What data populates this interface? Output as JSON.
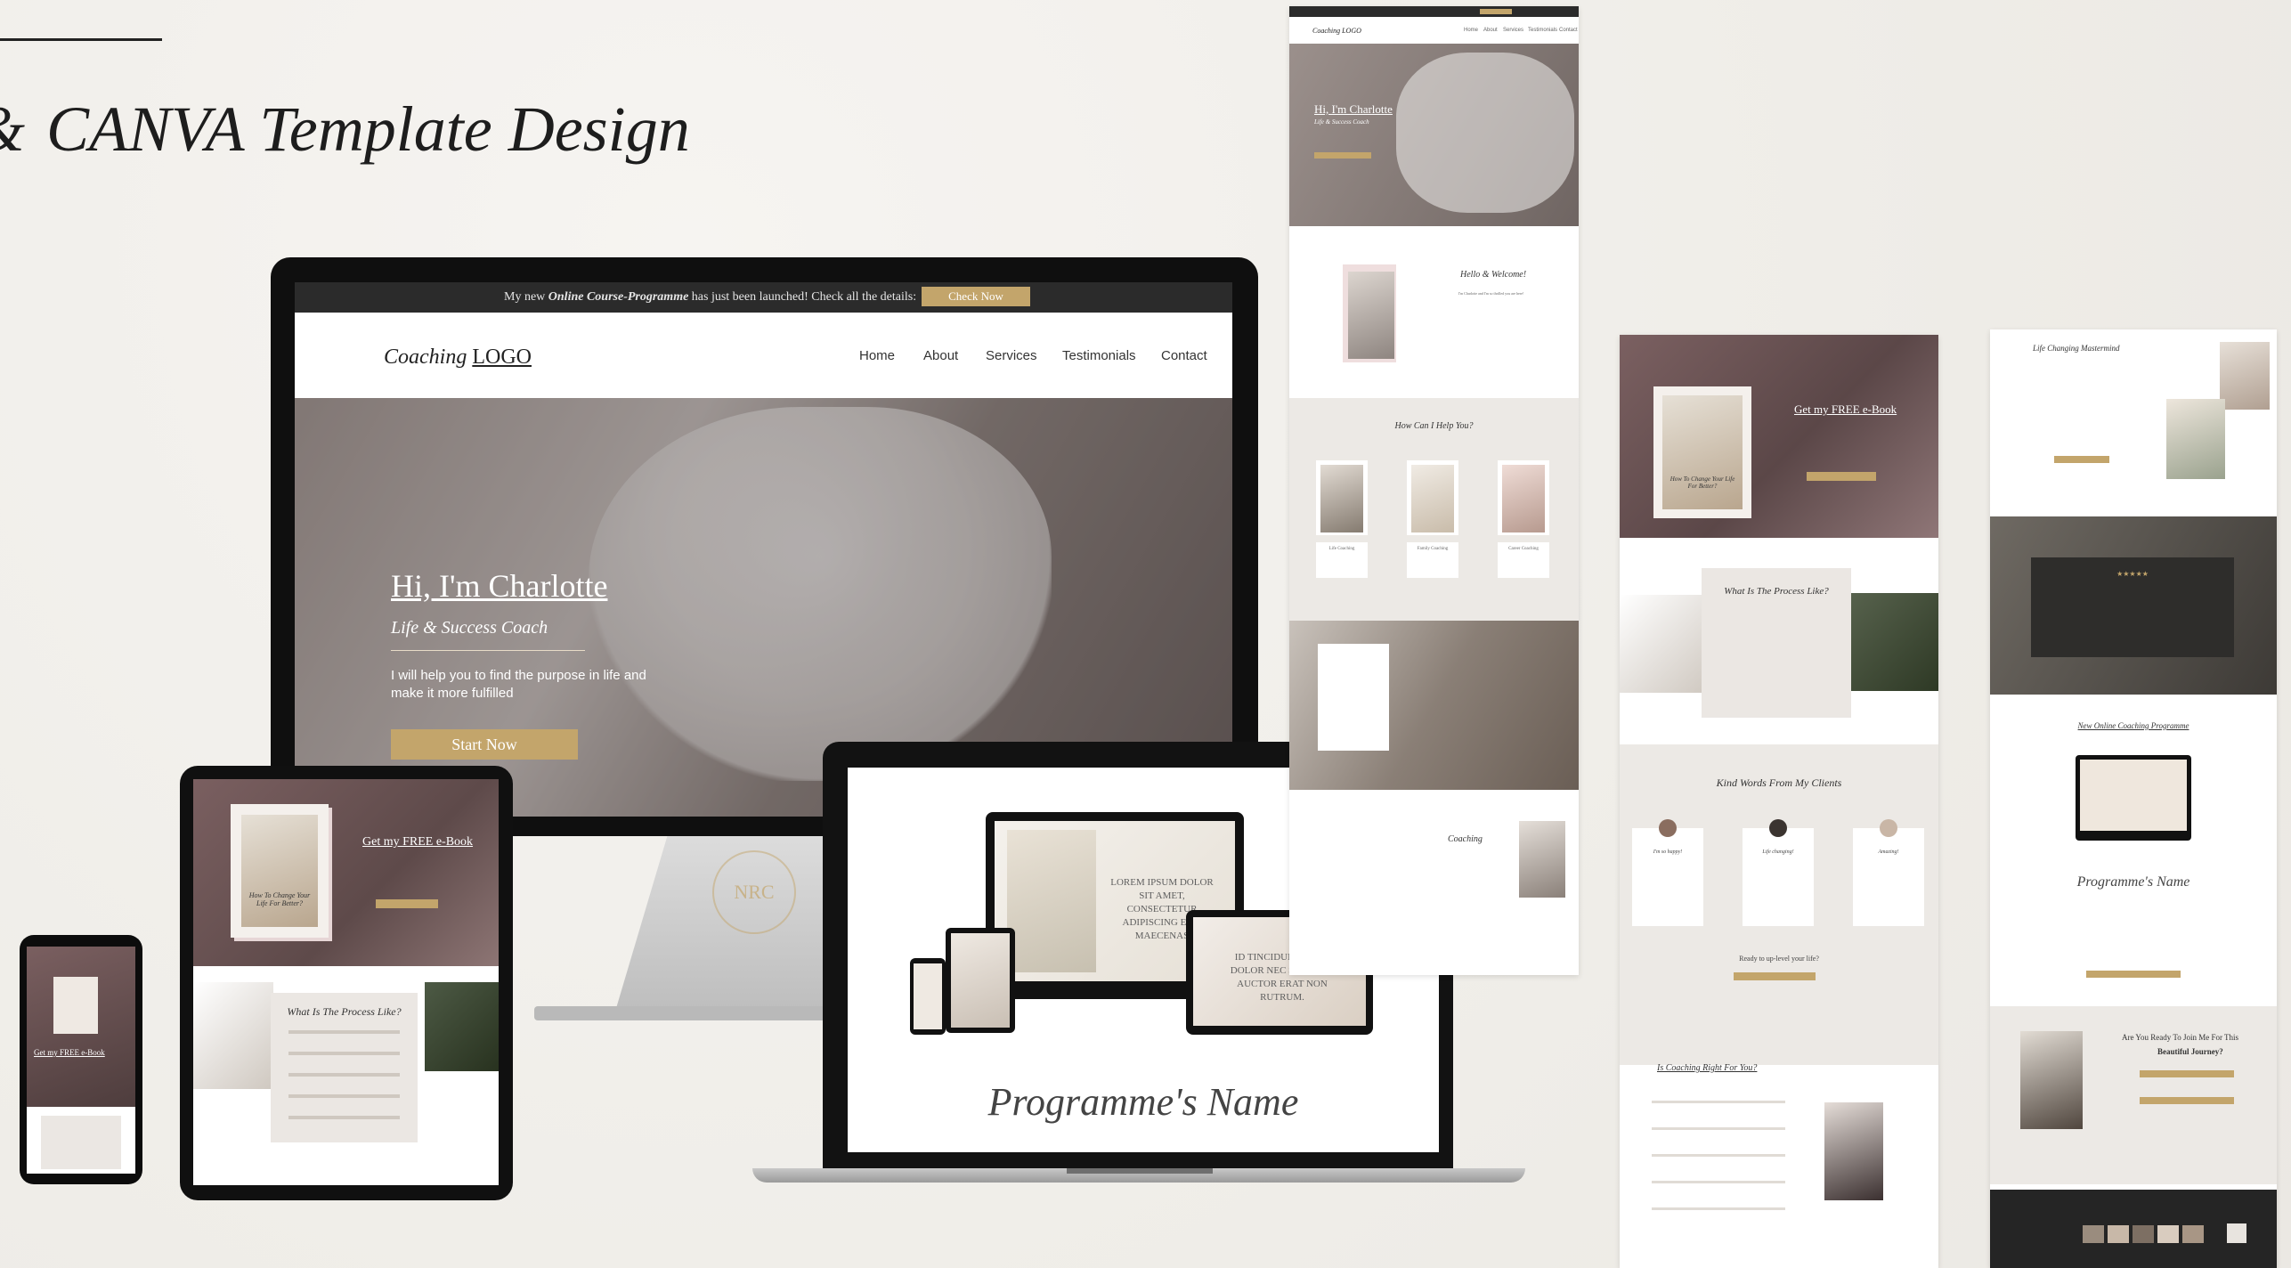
{
  "heading": "CANVA Template Design",
  "monitor": {
    "topbar_prefix": "My new ",
    "topbar_em": "Online Course-Programme",
    "topbar_suffix": " has just been launched! Check all the details:",
    "check_btn": "Check Now",
    "logo_script": "Coaching",
    "logo_word": "LOGO",
    "nav": [
      "Home",
      "About",
      "Services",
      "Testimonials",
      "Contact"
    ],
    "hero_title": "Hi, I'm Charlotte",
    "hero_subtitle": "Life & Success Coach",
    "hero_body": "I will help you to find the purpose in life and make it more fulfilled",
    "start_btn": "Start Now",
    "seal": "NRC"
  },
  "tablet": {
    "ebook": "Get my FREE e-Book",
    "book_text": "How To Change Your Life For Better?",
    "process_title": "What Is The Process Like?"
  },
  "phone": {
    "ebook": "Get my FREE e-Book"
  },
  "laptop": {
    "mon_text": "LOREM IPSUM DOLOR SIT AMET, CONSECTETUR ADIPISCING ELIT MAECENAS",
    "lap_text": "ID TINCIDUNT ARCU DOLOR NEC SEM NAM AUCTOR ERAT NON RUTRUM.",
    "script": "Programme's Name"
  },
  "page1": {
    "logo": "Coaching LOGO",
    "nav": [
      "Home",
      "About",
      "Services",
      "Testimonials",
      "Contact"
    ],
    "hero_title": "Hi, I'm Charlotte",
    "hero_sub": "Life & Success Coach",
    "welcome": "Hello & Welcome!",
    "welcome_sub": "I'm Charlotte and I'm so thrilled you are here!",
    "help_title": "How Can I Help You?",
    "services": [
      "Life Coaching",
      "Family Coaching",
      "Career Coaching"
    ],
    "coaching": "Coaching"
  },
  "page2": {
    "ebook": "Get my FREE e-Book",
    "book_text": "How To Change Your Life For Better?",
    "process_title": "What Is The Process Like?",
    "kind_words": "Kind Words From My Clients",
    "clients": [
      "I'm so happy!",
      "Life changing!",
      "Amazing!"
    ],
    "ready": "Ready to up-level your life?",
    "right_for_you": "Is Coaching Right For You?"
  },
  "page3": {
    "mastermind": "Life Changing Mastermind",
    "stars": "★★★★★",
    "new_programme": "New Online Coaching Programme",
    "programme_script": "Programme's Name",
    "ready_join": "Are You Ready To Join Me For This",
    "beautiful": "Beautiful Journey?"
  }
}
